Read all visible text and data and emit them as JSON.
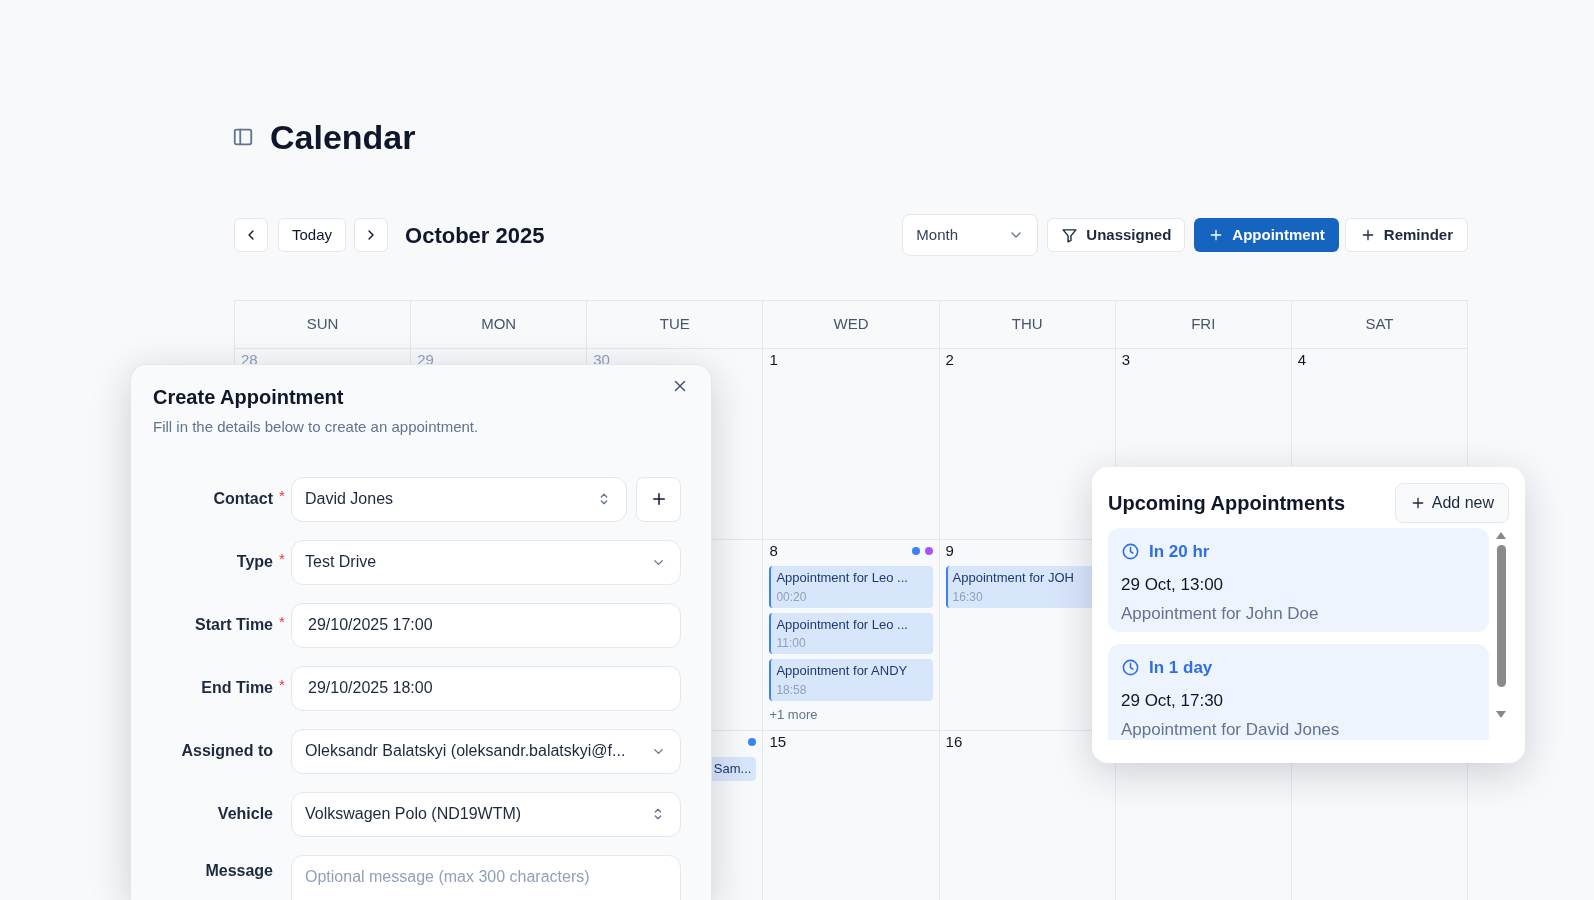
{
  "page": {
    "title": "Calendar"
  },
  "toolbar": {
    "today": "Today",
    "month_label": "October 2025",
    "view": "Month",
    "filter": "Unassigned",
    "primary": "Appointment",
    "secondary": "Reminder"
  },
  "weekdays": [
    "SUN",
    "MON",
    "TUE",
    "WED",
    "THU",
    "FRI",
    "SAT"
  ],
  "weeks": [
    {
      "days": [
        {
          "kind": "day",
          "number": "28",
          "muted": true
        },
        {
          "kind": "day",
          "number": "29",
          "muted": true
        },
        {
          "kind": "day",
          "number": "30",
          "muted": true
        },
        {
          "kind": "day",
          "number": "1",
          "muted": false
        },
        {
          "kind": "day",
          "number": "2",
          "muted": false
        },
        {
          "kind": "day",
          "number": "3",
          "muted": false
        },
        {
          "kind": "day",
          "number": "4",
          "muted": false
        }
      ]
    },
    {
      "days": [
        {
          "kind": "covered"
        },
        {
          "kind": "covered"
        },
        {
          "kind": "partly_covered"
        },
        {
          "kind": "day",
          "number": "8",
          "muted": false,
          "dots": [
            {
              "color": "#3b82f6"
            },
            {
              "color": "#a855f7"
            }
          ],
          "events": [
            {
              "title": "Appointment for Leo ...",
              "time": "00:20"
            },
            {
              "title": "Appointment for Leo ...",
              "time": "11:00"
            },
            {
              "title": "Appointment for ANDY",
              "time": "18:58"
            }
          ],
          "more": "+1 more"
        },
        {
          "kind": "day",
          "number": "9",
          "muted": false,
          "events": [
            {
              "title": "Appointment for JOH",
              "time": "16:30"
            }
          ]
        },
        {
          "kind": "covered"
        },
        {
          "kind": "covered"
        }
      ]
    },
    {
      "days": [
        {
          "kind": "covered"
        },
        {
          "kind": "covered"
        },
        {
          "kind": "day",
          "dots": [
            {
              "color": "#3b82f6"
            }
          ],
          "events": [
            {
              "title": "Sam..."
            }
          ]
        },
        {
          "kind": "day",
          "number": "15",
          "muted": false
        },
        {
          "kind": "day",
          "number": "16",
          "muted": false
        },
        {
          "kind": "covered"
        },
        {
          "kind": "covered"
        }
      ]
    }
  ],
  "dialog": {
    "title": "Create Appointment",
    "subtitle": "Fill in the details below to create an appointment.",
    "fields": [
      {
        "label": "Contact",
        "required": true,
        "required_mark": "*",
        "kind": "combo",
        "value": "David Jones",
        "add_button": true
      },
      {
        "label": "Type",
        "required": true,
        "required_mark": "*",
        "kind": "select",
        "value": "Test Drive"
      },
      {
        "label": "Start Time",
        "required": true,
        "required_mark": "*",
        "kind": "input",
        "value": "29/10/2025 17:00"
      },
      {
        "label": "End Time",
        "required": true,
        "required_mark": "*",
        "kind": "input",
        "value": "29/10/2025 18:00"
      },
      {
        "label": "Assigned to",
        "required": false,
        "kind": "select",
        "value": "Oleksandr Balatskyi (oleksandr.balatskyi@f..."
      },
      {
        "label": "Vehicle",
        "required": false,
        "kind": "combo",
        "value": "Volkswagen Polo (ND19WTM)"
      },
      {
        "label": "Message",
        "required": false,
        "kind": "textarea",
        "placeholder": "Optional message (max 300 characters)"
      }
    ]
  },
  "upcoming": {
    "title": "Upcoming Appointments",
    "add_button": "Add new",
    "items": [
      {
        "relative": "In 20 hr",
        "when": "29 Oct, 13:00",
        "title": "Appointment for John Doe"
      },
      {
        "relative": "In 1 day",
        "when": "29 Oct, 17:30",
        "title": "Appointment for David Jones"
      }
    ]
  }
}
